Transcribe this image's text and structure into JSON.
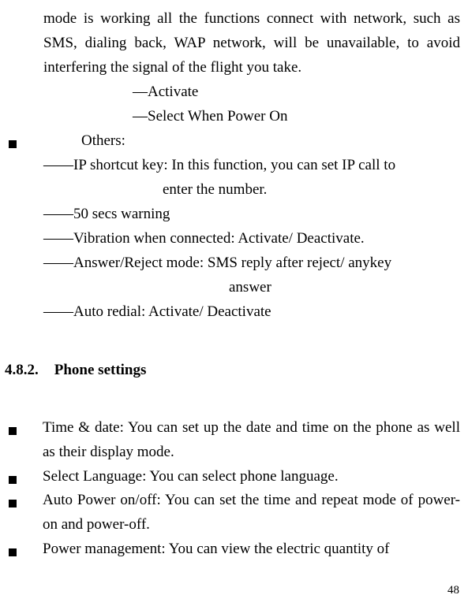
{
  "para1": "mode is working all the functions connect with network, such as SMS, dialing back, WAP network, will be unavailable, to avoid interfering the signal of the flight you take.",
  "sub1": "―Activate",
  "sub2": "―Select When Power On",
  "othersLabel": "Others:",
  "dash1": "――IP shortcut key: In this function, you can set IP call to",
  "dash1cont": "enter the number.",
  "dash2": "――50 secs warning",
  "dash3": "――Vibration when connected: Activate/ Deactivate.",
  "dash4": "――Answer/Reject mode: SMS reply after reject/ anykey",
  "dash4cont": "answer",
  "dash5": "――Auto redial: Activate/ Deactivate",
  "sectionNum": "4.8.2.",
  "sectionTitle": "Phone settings",
  "bullet1": "Time & date: You can set up the date and time on the phone as well as their display mode.",
  "bullet2": "Select Language: You can select phone language.",
  "bullet3": "Auto Power on/off: You can set the time and repeat mode of power-on and power-off.",
  "bullet4": "Power management: You can view the electric quantity of",
  "pageNum": "48"
}
